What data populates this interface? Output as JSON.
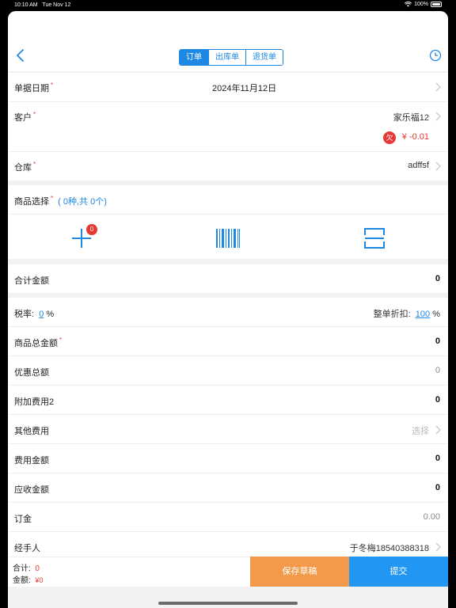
{
  "status": {
    "time": "10:10 AM",
    "date": "Tue Nov 12",
    "battery": "100%"
  },
  "tabs": [
    {
      "label": "订单",
      "active": true
    },
    {
      "label": "出库单",
      "active": false
    },
    {
      "label": "退货单",
      "active": false
    }
  ],
  "form": {
    "date": {
      "label": "单据日期",
      "value": "2024年11月12日"
    },
    "customer": {
      "label": "客户",
      "value": "家乐福12",
      "debt_badge": "欠",
      "debt_value": "¥ -0.01"
    },
    "warehouse": {
      "label": "仓库",
      "value": "adffsf"
    },
    "goods": {
      "label": "商品选择",
      "summary": "( 0种,共 0个)",
      "cart_count": "0"
    },
    "total_amount": {
      "label": "合计金额",
      "value": "0"
    },
    "tax": {
      "label": "税率:",
      "value": "0",
      "unit": "%"
    },
    "discount": {
      "label": "整单折扣:",
      "value": "100",
      "unit": "%"
    },
    "goods_total": {
      "label": "商品总金额",
      "value": "0"
    },
    "promo_total": {
      "label": "优惠总额",
      "value": "0"
    },
    "extra_fee": {
      "label": "附加费用2",
      "value": "0"
    },
    "other_fee": {
      "label": "其他费用",
      "placeholder": "选择"
    },
    "fee_amount": {
      "label": "费用金额",
      "value": "0"
    },
    "receivable": {
      "label": "应收金额",
      "value": "0"
    },
    "deposit": {
      "label": "订金",
      "value": "0.00"
    },
    "handler": {
      "label": "经手人",
      "value": "于冬梅18540388318"
    }
  },
  "footer": {
    "count_label": "合计:",
    "count_value": "0",
    "amount_label": "金额:",
    "amount_value": "¥0",
    "draft_label": "保存草稿",
    "submit_label": "提交"
  },
  "colors": {
    "accent": "#1e88e5",
    "danger": "#e53935",
    "draft": "#f39a4a",
    "submit": "#2196f3"
  }
}
